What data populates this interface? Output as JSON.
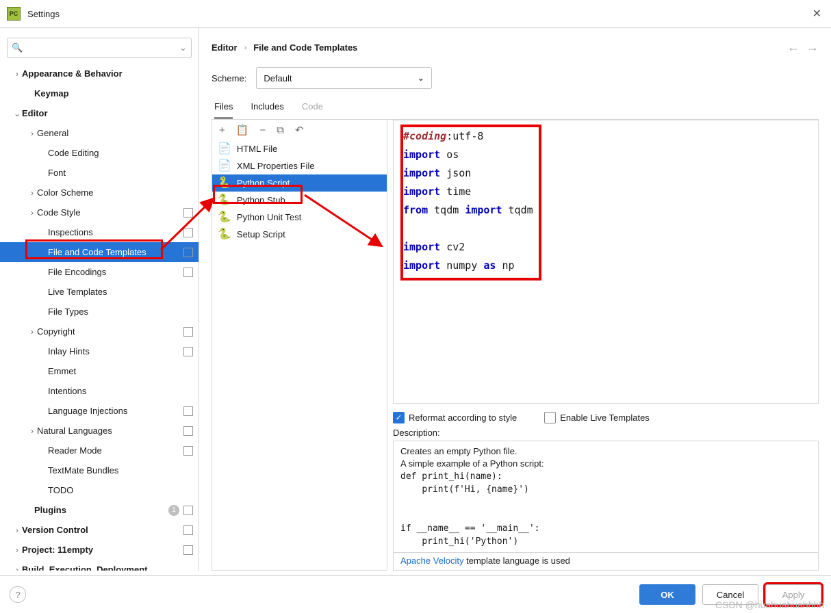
{
  "window": {
    "title": "Settings"
  },
  "search": {
    "placeholder": ""
  },
  "tree": [
    {
      "label": "Appearance & Behavior",
      "indent": 18,
      "chev": "›",
      "bold": true
    },
    {
      "label": "Keymap",
      "indent": 36,
      "bold": true
    },
    {
      "label": "Editor",
      "indent": 18,
      "chev": "⌄",
      "bold": true
    },
    {
      "label": "General",
      "indent": 40,
      "chev": "›"
    },
    {
      "label": "Code Editing",
      "indent": 56
    },
    {
      "label": "Font",
      "indent": 56
    },
    {
      "label": "Color Scheme",
      "indent": 40,
      "chev": "›"
    },
    {
      "label": "Code Style",
      "indent": 40,
      "chev": "›",
      "proj": true
    },
    {
      "label": "Inspections",
      "indent": 56,
      "proj": true
    },
    {
      "label": "File and Code Templates",
      "indent": 56,
      "proj": true,
      "sel": true
    },
    {
      "label": "File Encodings",
      "indent": 56,
      "proj": true
    },
    {
      "label": "Live Templates",
      "indent": 56
    },
    {
      "label": "File Types",
      "indent": 56
    },
    {
      "label": "Copyright",
      "indent": 40,
      "chev": "›",
      "proj": true
    },
    {
      "label": "Inlay Hints",
      "indent": 56,
      "proj": true
    },
    {
      "label": "Emmet",
      "indent": 56
    },
    {
      "label": "Intentions",
      "indent": 56
    },
    {
      "label": "Language Injections",
      "indent": 56,
      "proj": true
    },
    {
      "label": "Natural Languages",
      "indent": 40,
      "chev": "›",
      "proj": true
    },
    {
      "label": "Reader Mode",
      "indent": 56,
      "proj": true
    },
    {
      "label": "TextMate Bundles",
      "indent": 56
    },
    {
      "label": "TODO",
      "indent": 56
    },
    {
      "label": "Plugins",
      "indent": 36,
      "bold": true,
      "badge": "1",
      "proj": true
    },
    {
      "label": "Version Control",
      "indent": 18,
      "chev": "›",
      "bold": true,
      "proj": true
    },
    {
      "label": "Project: 11empty",
      "indent": 18,
      "chev": "›",
      "bold": true,
      "proj": true
    },
    {
      "label": "Build, Execution, Deployment",
      "indent": 18,
      "chev": "›",
      "bold": true
    }
  ],
  "breadcrumb": {
    "seg1": "Editor",
    "seg2": "File and Code Templates"
  },
  "scheme": {
    "label": "Scheme:",
    "value": "Default"
  },
  "tabs": [
    {
      "label": "Files",
      "state": "active"
    },
    {
      "label": "Includes",
      "state": ""
    },
    {
      "label": "Code",
      "state": "dis"
    }
  ],
  "toolbar_icons": [
    "+",
    "📋",
    "−",
    "⧉",
    "↶"
  ],
  "templates": [
    {
      "label": "HTML File",
      "icon": "📄",
      "icolor": "#6bb53b"
    },
    {
      "label": "XML Properties File",
      "icon": "📄",
      "icolor": "#8a8a8a"
    },
    {
      "label": "Python Script",
      "icon": "🐍",
      "icolor": "#2675d6",
      "sel": true
    },
    {
      "label": "Python Stub",
      "icon": "🐍",
      "icolor": "#2675d6"
    },
    {
      "label": "Python Unit Test",
      "icon": "🐍",
      "icolor": "#2675d6"
    },
    {
      "label": "Setup Script",
      "icon": "🐍",
      "icolor": "#2675d6"
    }
  ],
  "code": {
    "l1a": "#coding",
    "l1b": ":utf-8",
    "kw_import": "import",
    "kw_from": "from",
    "kw_as": "as",
    "id_os": " os",
    "id_json": " json",
    "id_time": " time",
    "id_tqdm1": " tqdm ",
    "id_tqdm2": " tqdm",
    "id_cv2": " cv2",
    "id_numpy": " numpy ",
    "id_np": " np"
  },
  "options": {
    "reformat": {
      "label": "Reformat according to style",
      "checked": true
    },
    "live": {
      "label": "Enable Live Templates",
      "checked": false
    }
  },
  "desc": {
    "label": "Description:",
    "l1": "Creates an empty Python file.",
    "l2": "A simple example of a Python script:",
    "l3": "def print_hi(name):",
    "l4": "    print(f'Hi, {name}')",
    "l5": "",
    "l6": "if __name__ == '__main__':",
    "l7": "    print_hi('Python')",
    "link": "Apache Velocity",
    "tail": " template language is used"
  },
  "buttons": {
    "ok": "OK",
    "cancel": "Cancel",
    "apply": "Apply"
  },
  "watermark": "CSDN @huahuahuahhhh"
}
